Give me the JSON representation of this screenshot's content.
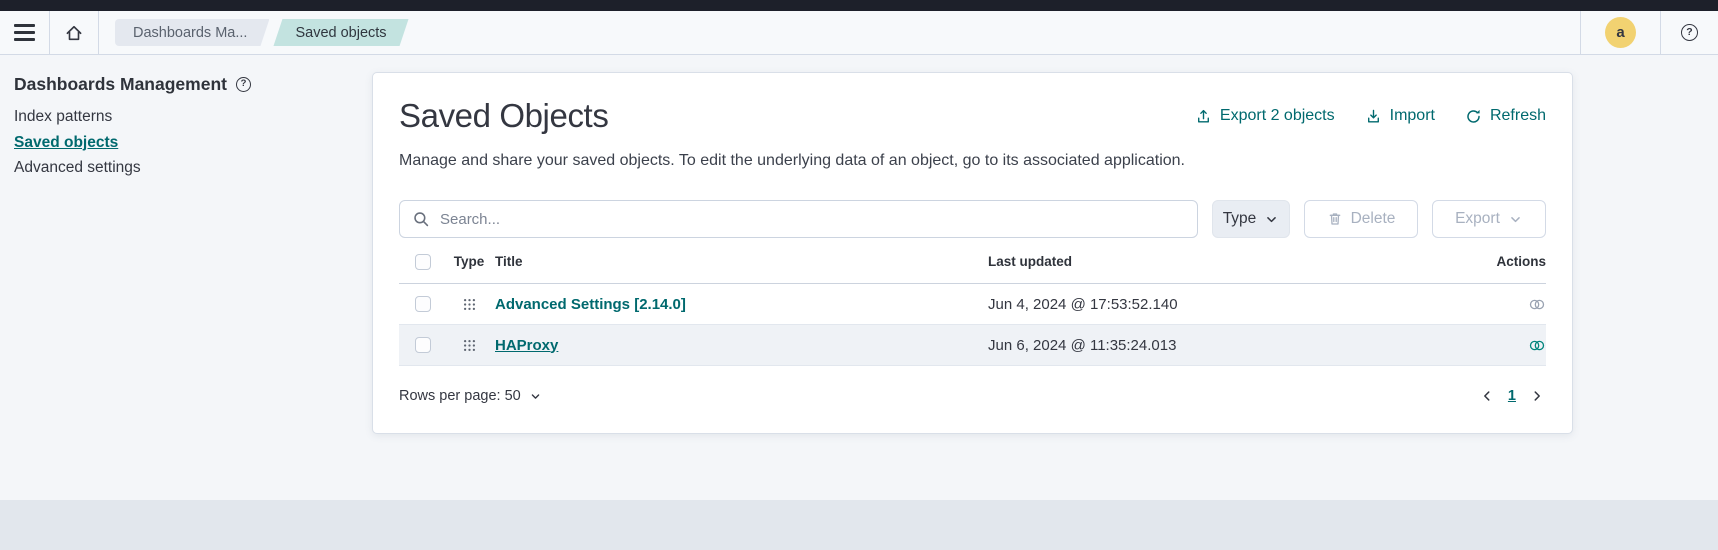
{
  "header": {
    "breadcrumbs": {
      "prev": "Dashboards Ma...",
      "current": "Saved objects"
    },
    "avatar_text": "a"
  },
  "sidebar": {
    "title": "Dashboards Management",
    "items": [
      {
        "label": "Index patterns"
      },
      {
        "label": "Saved objects"
      },
      {
        "label": "Advanced settings"
      }
    ]
  },
  "main": {
    "title": "Saved Objects",
    "description": "Manage and share your saved objects. To edit the underlying data of an object, go to its associated application.",
    "header_actions": {
      "export_all": "Export 2 objects",
      "import": "Import",
      "refresh": "Refresh"
    },
    "toolbar": {
      "search_placeholder": "Search...",
      "type_filter": "Type",
      "delete": "Delete",
      "export": "Export"
    },
    "table": {
      "headers": {
        "type": "Type",
        "title": "Title",
        "last_updated": "Last updated",
        "actions": "Actions"
      },
      "rows": [
        {
          "title": "Advanced Settings [2.14.0]",
          "last_updated": "Jun 4, 2024 @ 17:53:52.140"
        },
        {
          "title": "HAProxy",
          "last_updated": "Jun 6, 2024 @ 11:35:24.013"
        }
      ]
    },
    "footer": {
      "rows_per_page": "Rows per page: 50",
      "page": "1"
    }
  },
  "colors": {
    "accent_teal": "#00696E",
    "breadcrumb_active_bg": "#C3E3E0",
    "avatar_bg": "#F2D271",
    "topbar": "#1D202A",
    "hover_row_bg": "#EFF2F6"
  }
}
